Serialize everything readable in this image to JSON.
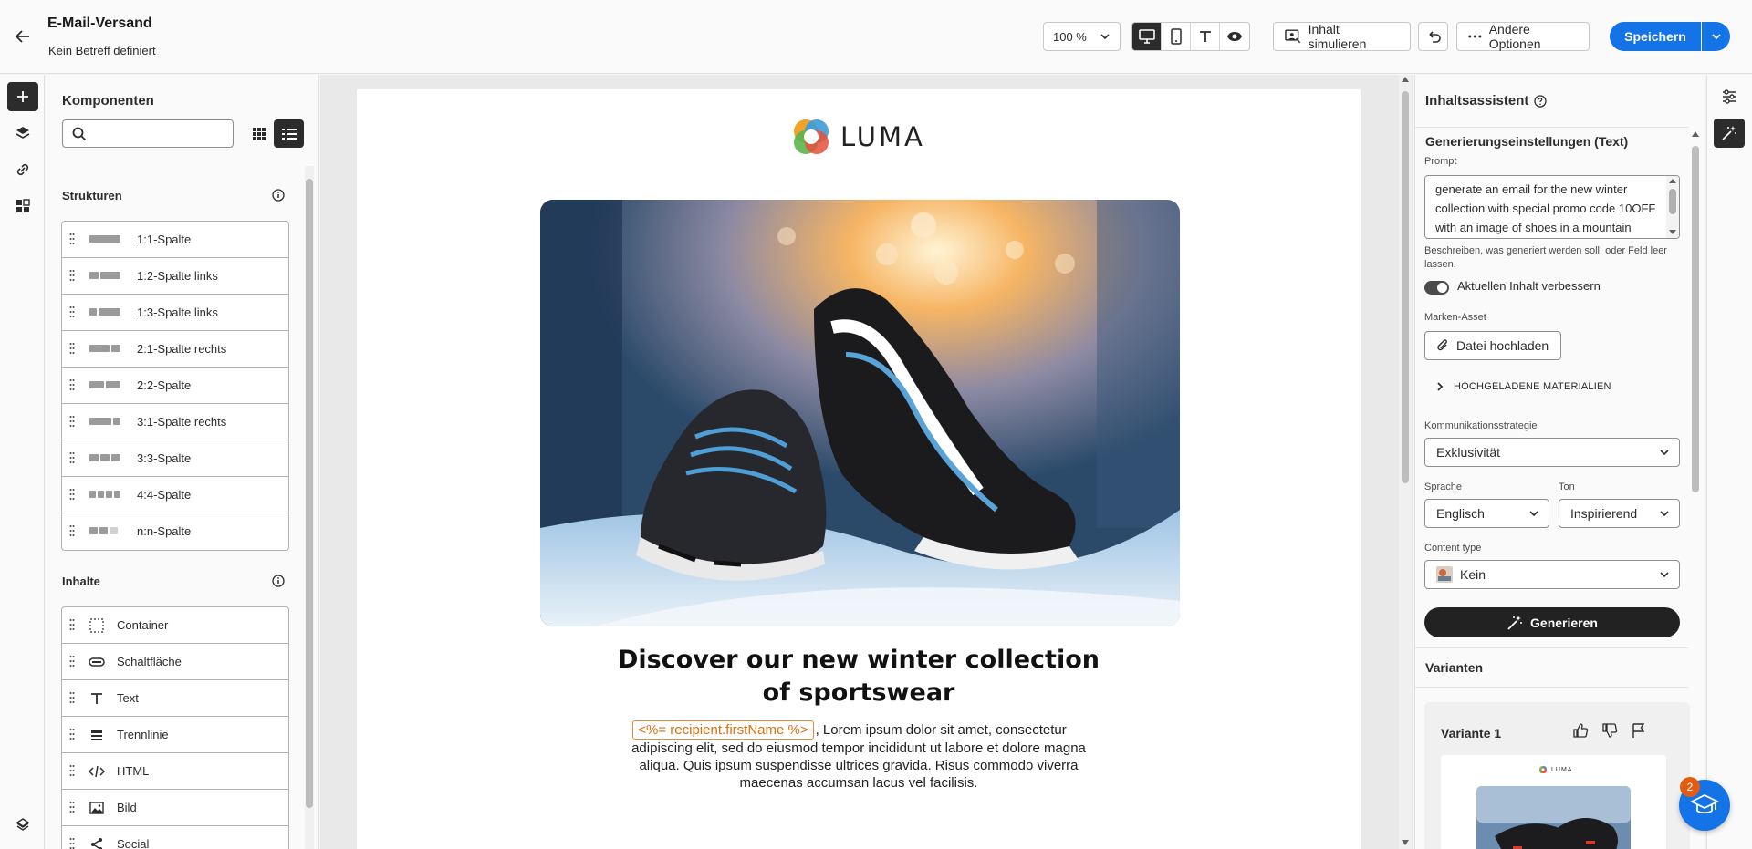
{
  "header": {
    "title": "E-Mail-Versand",
    "subtitle": "Kein Betreff definiert",
    "zoom": "100 %",
    "simulate_label": "Inhalt simulieren",
    "more_options_label": "Andere Optionen",
    "save_label": "Speichern"
  },
  "components": {
    "title": "Komponenten",
    "search_placeholder": "",
    "structures_title": "Strukturen",
    "structures": [
      {
        "label": "1:1-Spalte"
      },
      {
        "label": "1:2-Spalte links"
      },
      {
        "label": "1:3-Spalte links"
      },
      {
        "label": "2:1-Spalte rechts"
      },
      {
        "label": "2:2-Spalte"
      },
      {
        "label": "3:1-Spalte rechts"
      },
      {
        "label": "3:3-Spalte"
      },
      {
        "label": "4:4-Spalte"
      },
      {
        "label": "n:n-Spalte"
      }
    ],
    "contents_title": "Inhalte",
    "contents": [
      {
        "label": "Container",
        "icon": "container-icon"
      },
      {
        "label": "Schaltfläche",
        "icon": "button-icon"
      },
      {
        "label": "Text",
        "icon": "text-icon"
      },
      {
        "label": "Trennlinie",
        "icon": "divider-icon"
      },
      {
        "label": "HTML",
        "icon": "code-icon"
      },
      {
        "label": "Bild",
        "icon": "image-icon"
      },
      {
        "label": "Social",
        "icon": "share-icon"
      }
    ]
  },
  "email": {
    "logo_text": "LUMA",
    "headline": "Discover our new winter collection of sportswear",
    "token": "<%= recipient.firstName %>",
    "body": ", Lorem ipsum dolor sit amet, consectetur adipiscing elit, sed do eiusmod tempor incididunt ut labore et dolore magna aliqua. Quis ipsum suspendisse ultrices gravida. Risus commodo viverra maecenas accumsan lacus vel facilisis."
  },
  "assistant": {
    "title": "Inhaltsassistent",
    "gen_settings": "Generierungseinstellungen (Text)",
    "prompt_label": "Prompt",
    "prompt_value": "generate an email for the new winter collection with special promo code 10OFF with an image of shoes in a mountain",
    "prompt_help": "Beschreiben, was generiert werden soll, oder Feld leer lassen.",
    "improve_label": "Aktuellen Inhalt verbessern",
    "improve_on": true,
    "brand_asset_label": "Marken-Asset",
    "upload_label": "Datei hochladen",
    "uploaded_materials": "HOCHGELADENE MATERIALIEN",
    "strategy_label": "Kommunikationsstrategie",
    "strategy_value": "Exklusivität",
    "language_label": "Sprache",
    "language_value": "Englisch",
    "tone_label": "Ton",
    "tone_value": "Inspirierend",
    "content_type_label": "Content type",
    "content_type_value": "Kein",
    "generate_label": "Generieren",
    "variants_title": "Varianten",
    "variant_title": "Variante 1",
    "variant_logo": "LUMA"
  },
  "help": {
    "badge": "2"
  },
  "colors": {
    "accent": "#1473e6",
    "token": "#d96f0f",
    "dark": "#2c2c2c"
  }
}
